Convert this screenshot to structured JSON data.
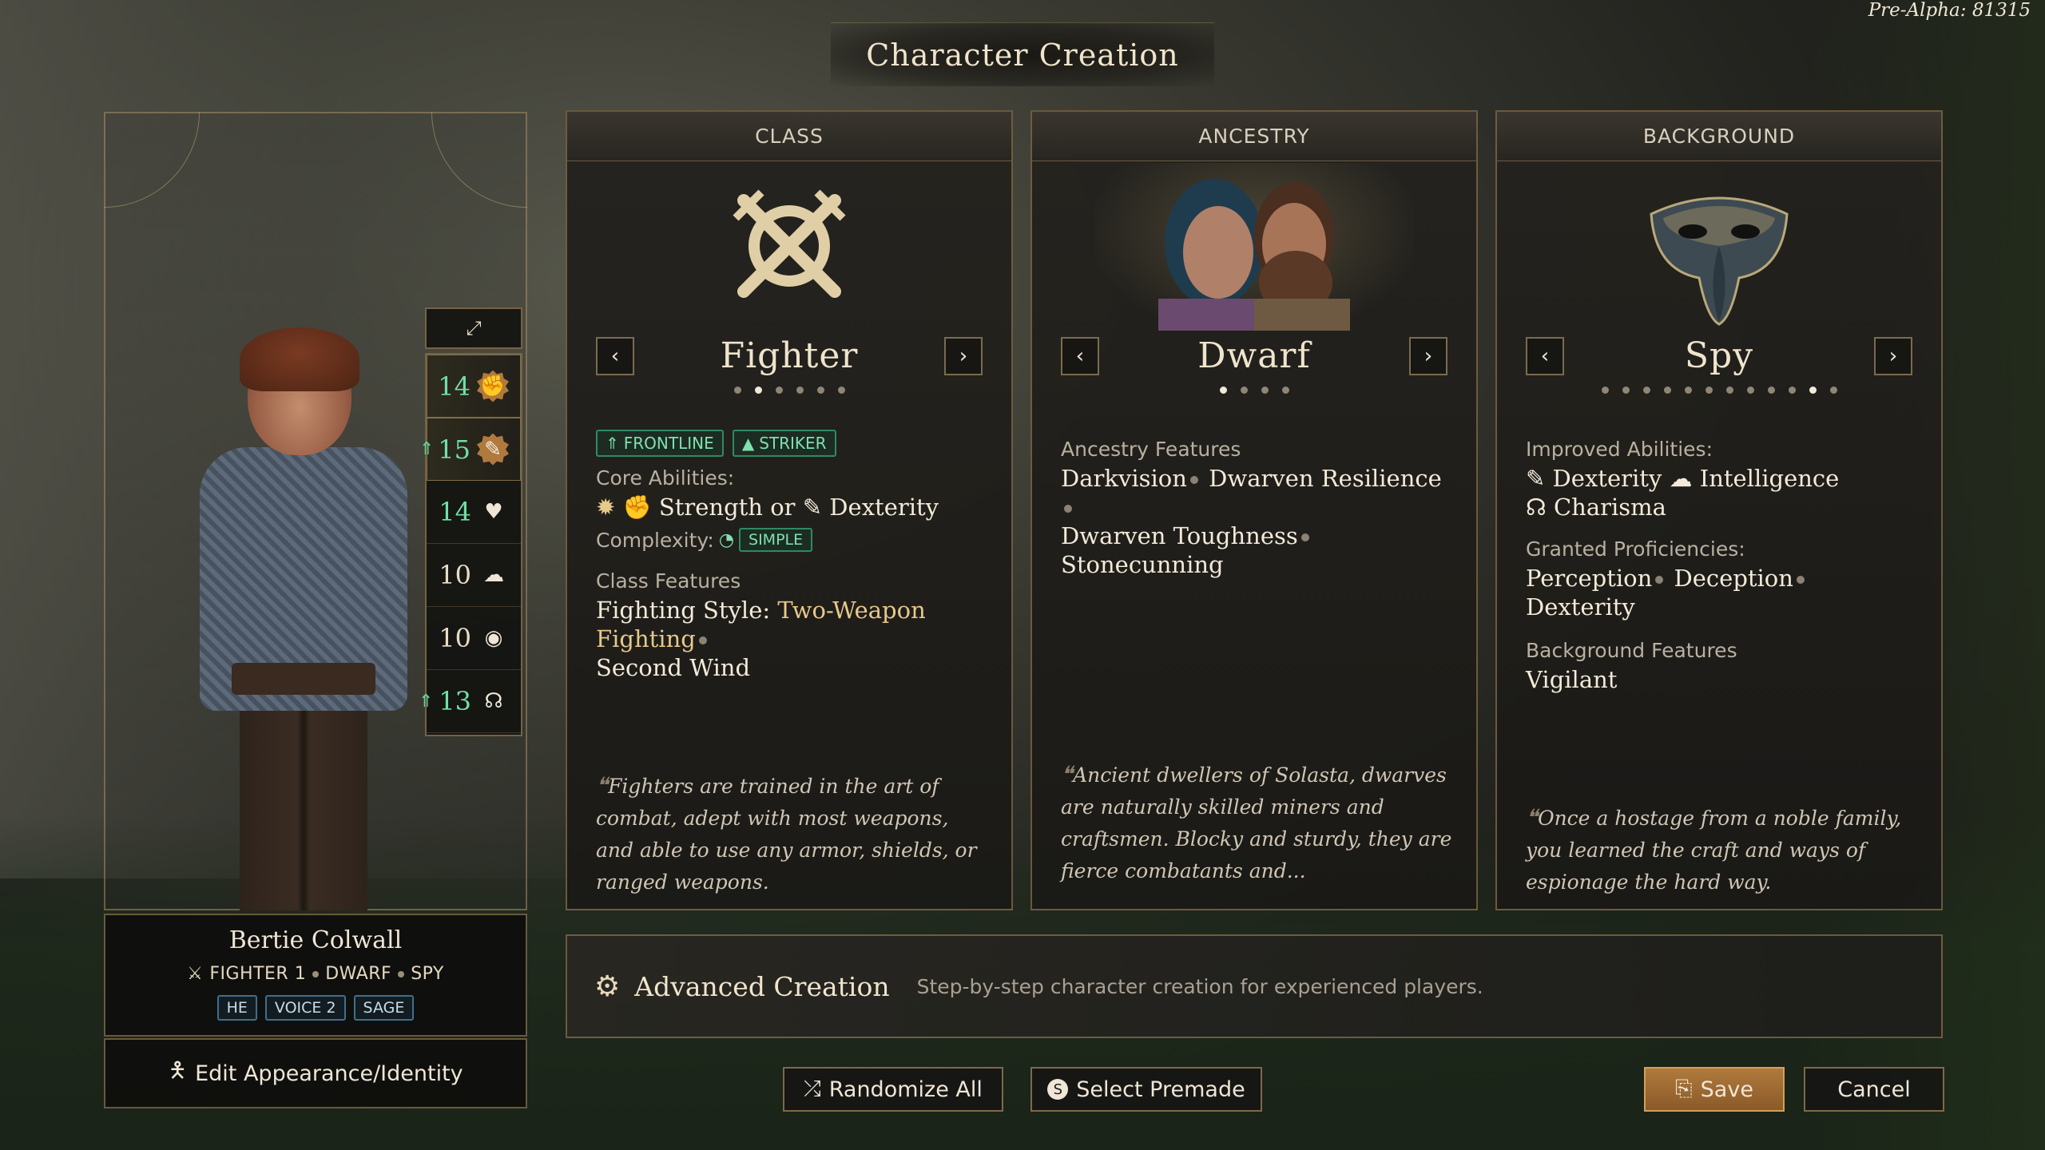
{
  "build": "Pre-Alpha: 81315",
  "title": "Character Creation",
  "stats": [
    {
      "value": "14",
      "icon": "strength-icon",
      "glyph": "✊",
      "badge": true,
      "up": false,
      "green": true
    },
    {
      "value": "15",
      "icon": "dexterity-icon",
      "glyph": "✎",
      "badge": true,
      "up": true,
      "green": true
    },
    {
      "value": "14",
      "icon": "constitution-icon",
      "glyph": "♥",
      "badge": false,
      "up": false,
      "green": true
    },
    {
      "value": "10",
      "icon": "intelligence-icon",
      "glyph": "☁",
      "badge": false,
      "up": false,
      "green": false
    },
    {
      "value": "10",
      "icon": "wisdom-icon",
      "glyph": "◉",
      "badge": false,
      "up": false,
      "green": false
    },
    {
      "value": "13",
      "icon": "charisma-icon",
      "glyph": "☊",
      "badge": false,
      "up": true,
      "green": true
    }
  ],
  "character": {
    "name": "Bertie Colwall",
    "class_level": "FIGHTER 1",
    "ancestry": "DWARF",
    "background": "SPY",
    "tags": [
      "HE",
      "VOICE 2",
      "SAGE"
    ],
    "edit_label": "Edit Appearance/Identity"
  },
  "class_card": {
    "header": "CLASS",
    "name": "Fighter",
    "roles": [
      "FRONTLINE",
      "STRIKER"
    ],
    "core_label": "Core Abilities:",
    "core_a": "Strength",
    "core_or": "or",
    "core_b": "Dexterity",
    "complexity_label": "Complexity:",
    "complexity": "SIMPLE",
    "features_label": "Class Features",
    "feature_1_a": "Fighting Style:",
    "feature_1_b": "Two-Weapon Fighting",
    "feature_2": "Second Wind",
    "quote": "Fighters are trained in the art of combat, adept with most weapons, and able to use any armor, shields, or ranged weapons.",
    "page_count": 6,
    "page_active": 1
  },
  "ancestry_card": {
    "header": "ANCESTRY",
    "name": "Dwarf",
    "features_label": "Ancestry Features",
    "features": [
      "Darkvision",
      "Dwarven Resilience",
      "Dwarven Toughness",
      "Stonecunning"
    ],
    "quote": "Ancient dwellers of Solasta, dwarves are naturally skilled miners and craftsmen. Blocky and sturdy, they are fierce combatants and...",
    "page_count": 4,
    "page_active": 0
  },
  "background_card": {
    "header": "BACKGROUND",
    "name": "Spy",
    "abilities_label": "Improved Abilities:",
    "abilities": [
      "Dexterity",
      "Intelligence",
      "Charisma"
    ],
    "proficiencies_label": "Granted Proficiencies:",
    "proficiencies": [
      "Perception",
      "Deception",
      "Dexterity"
    ],
    "features_label": "Background Features",
    "feature": "Vigilant",
    "quote": "Once a hostage from a noble family, you learned the craft and ways of espionage the hard way.",
    "page_count": 12,
    "page_active": 10
  },
  "advanced": {
    "title": "Advanced Creation",
    "description": "Step-by-step character creation for experienced players."
  },
  "buttons": {
    "randomize": "Randomize All",
    "premade": "Select Premade",
    "save": "Save",
    "cancel": "Cancel"
  }
}
